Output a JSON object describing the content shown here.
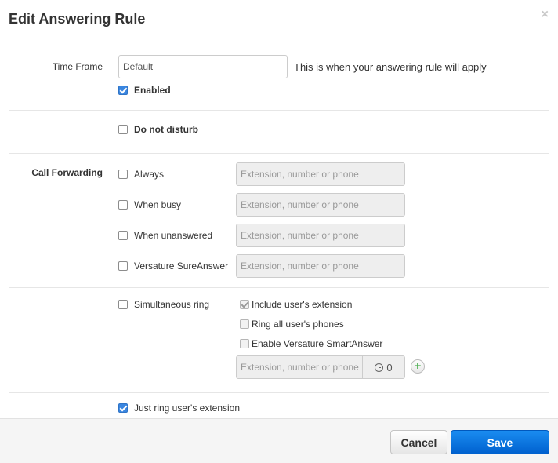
{
  "dialog": {
    "title": "Edit Answering Rule",
    "close_icon": "×"
  },
  "time_frame": {
    "label": "Time Frame",
    "value": "Default",
    "hint": "This is when your answering rule will apply",
    "enabled_label": "Enabled",
    "enabled_checked": true
  },
  "do_not_disturb": {
    "label": "Do not disturb",
    "checked": false
  },
  "call_forwarding": {
    "section_label": "Call Forwarding",
    "placeholder": "Extension, number or phone",
    "options": [
      {
        "label": "Always",
        "checked": false
      },
      {
        "label": "When busy",
        "checked": false
      },
      {
        "label": "When unanswered",
        "checked": false
      },
      {
        "label": "Versature SureAnswer",
        "checked": false
      }
    ]
  },
  "simultaneous_ring": {
    "label": "Simultaneous ring",
    "checked": false,
    "sub_options": [
      {
        "label": "Include user's extension",
        "checked": true
      },
      {
        "label": "Ring all user's phones",
        "checked": false
      },
      {
        "label": "Enable Versature SmartAnswer",
        "checked": false
      }
    ],
    "input_placeholder": "Extension, number or phone",
    "delay_value": "0",
    "add_icon": "+"
  },
  "just_ring": {
    "label": "Just ring user's extension",
    "checked": true
  },
  "footer": {
    "cancel_label": "Cancel",
    "save_label": "Save"
  },
  "colors": {
    "accent": "#0a74de",
    "checkbox_checked": "#3a86e0"
  }
}
